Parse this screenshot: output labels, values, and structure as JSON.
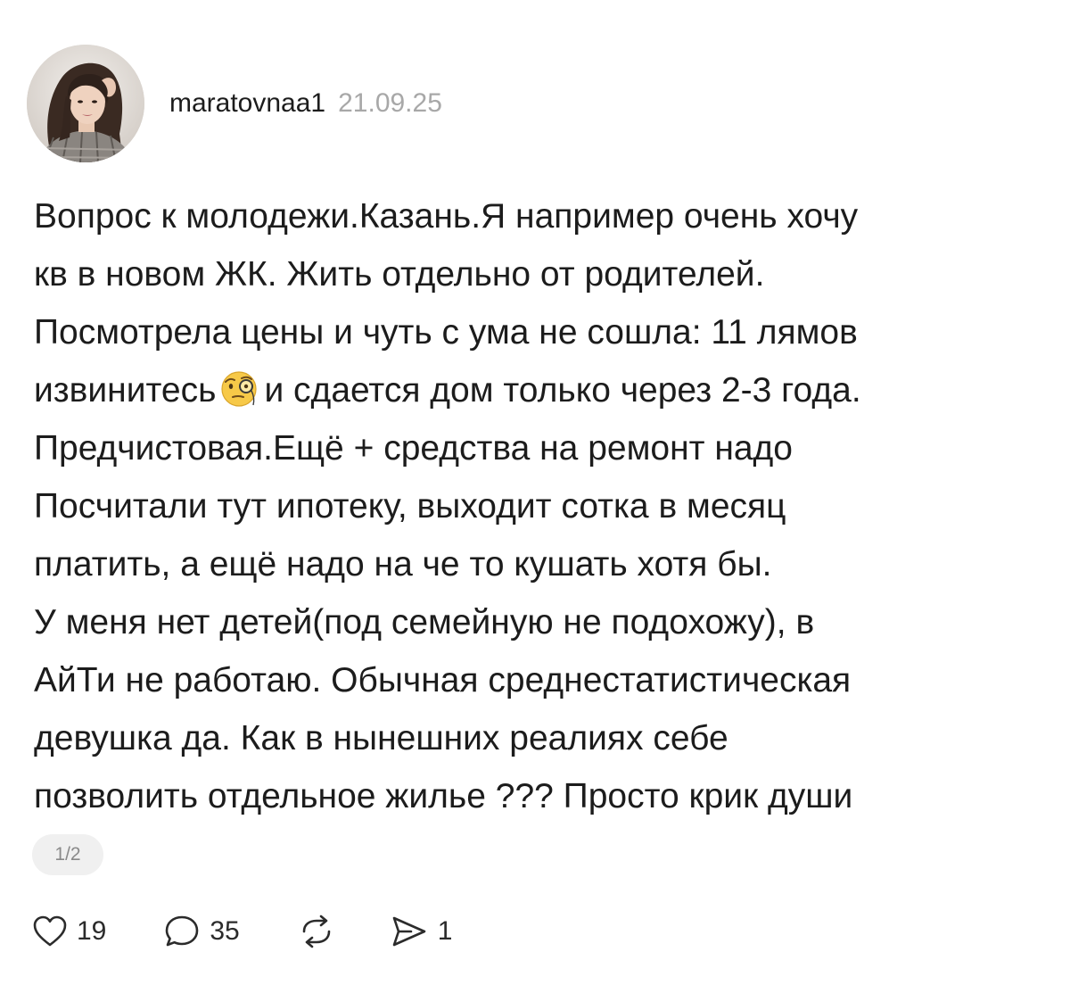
{
  "post": {
    "username": "maratovnaa1",
    "date": "21.09.25",
    "lines": [
      "Вопрос к молодежи.Казань.Я например очень хочу",
      "кв в новом ЖК. Жить отдельно от родителей.",
      "Посмотрела цены и чуть с ума не сошла: 11 лямов",
      "извинитесь",
      "и сдается дом только через 2-3 года.",
      "Предчистовая.Ещё + средства на ремонт надо",
      "Посчитали тут ипотеку, выходит сотка в месяц",
      "платить, а ещё надо на че то кушать хотя бы.",
      "У меня нет детей(под семейную не подохожу), в",
      "АйТи не работаю. Обычная среднестатистическая",
      "девушка да. Как в нынешних реалиях себе",
      "позволить отдельное жилье ??? Просто крик души"
    ],
    "emoji_icon": "face-with-monocle-icon",
    "pager": "1/2"
  },
  "actions": {
    "likes": "19",
    "comments": "35",
    "shares": "1"
  }
}
